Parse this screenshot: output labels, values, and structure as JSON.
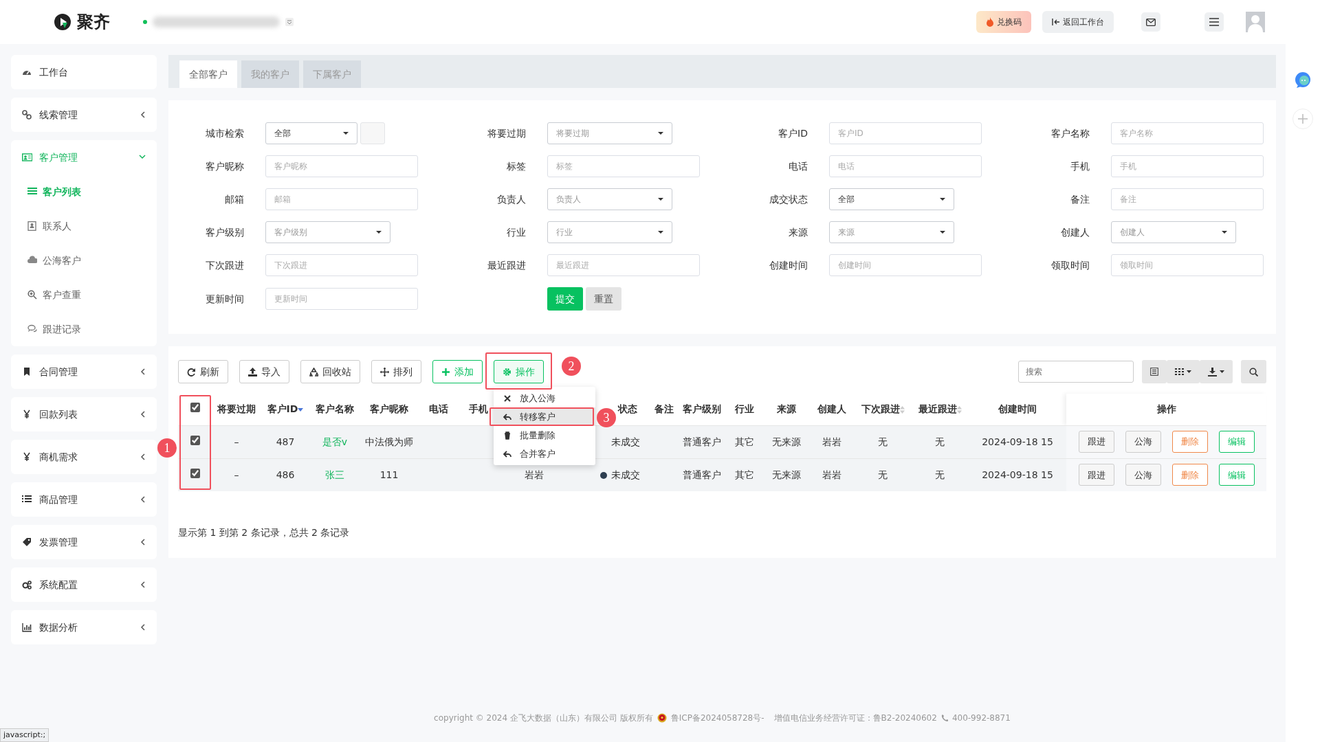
{
  "header": {
    "brand": "聚齐",
    "buttons": [
      {
        "label": "兑换码",
        "kind": "promo"
      },
      {
        "label": "返回工作台",
        "kind": "plain"
      }
    ]
  },
  "sidebar": {
    "items": [
      {
        "label": "工作台"
      },
      {
        "label": "线索管理",
        "expanded": false
      },
      {
        "label": "客户管理",
        "expanded": true,
        "children": [
          {
            "label": "客户列表",
            "selected": true
          },
          {
            "label": "联系人",
            "selected": false
          },
          {
            "label": "公海客户",
            "selected": false
          },
          {
            "label": "客户查重",
            "selected": false
          },
          {
            "label": "跟进记录",
            "selected": false
          }
        ]
      },
      {
        "label": "合同管理",
        "expanded": false
      },
      {
        "label": "回款列表",
        "expanded": false
      },
      {
        "label": "商机需求",
        "expanded": false
      },
      {
        "label": "商品管理",
        "expanded": false
      },
      {
        "label": "发票管理",
        "expanded": false
      },
      {
        "label": "系统配置",
        "expanded": false
      },
      {
        "label": "数据分析",
        "expanded": false
      }
    ]
  },
  "tabs": [
    {
      "label": "全部客户",
      "selected": true
    },
    {
      "label": "我的客户",
      "selected": false
    },
    {
      "label": "下属客户",
      "selected": false
    }
  ],
  "filters": [
    {
      "label": "城市检索",
      "kind": "select",
      "value": "全部",
      "addon": true
    },
    {
      "label": "将要过期",
      "kind": "select",
      "placeholder": "将要过期"
    },
    {
      "label": "客户ID",
      "kind": "input",
      "placeholder": "客户ID"
    },
    {
      "label": "客户名称",
      "kind": "input",
      "placeholder": "客户名称"
    },
    {
      "label": "客户昵称",
      "kind": "input",
      "placeholder": "客户昵称"
    },
    {
      "label": "标签",
      "kind": "input",
      "placeholder": "标签"
    },
    {
      "label": "电话",
      "kind": "input",
      "placeholder": "电话"
    },
    {
      "label": "手机",
      "kind": "input",
      "placeholder": "手机"
    },
    {
      "label": "邮箱",
      "kind": "input",
      "placeholder": "邮箱"
    },
    {
      "label": "负责人",
      "kind": "select",
      "placeholder": "负责人"
    },
    {
      "label": "成交状态",
      "kind": "select",
      "value": "全部"
    },
    {
      "label": "备注",
      "kind": "input",
      "placeholder": "备注"
    },
    {
      "label": "客户级别",
      "kind": "select",
      "placeholder": "客户级别"
    },
    {
      "label": "行业",
      "kind": "select",
      "placeholder": "行业"
    },
    {
      "label": "来源",
      "kind": "select",
      "placeholder": "来源"
    },
    {
      "label": "创建人",
      "kind": "select",
      "placeholder": "创建人"
    },
    {
      "label": "下次跟进",
      "kind": "input",
      "placeholder": "下次跟进"
    },
    {
      "label": "最近跟进",
      "kind": "input",
      "placeholder": "最近跟进"
    },
    {
      "label": "创建时间",
      "kind": "input",
      "placeholder": "创建时间"
    },
    {
      "label": "领取时间",
      "kind": "input",
      "placeholder": "领取时间"
    },
    {
      "label": "更新时间",
      "kind": "input",
      "placeholder": "更新时间"
    }
  ],
  "form_buttons": [
    {
      "label": "提交",
      "kind": "primary"
    },
    {
      "label": "重置",
      "kind": "secondary"
    }
  ],
  "toolbar": {
    "buttons": [
      {
        "label": "刷新",
        "kind": "default"
      },
      {
        "label": "导入",
        "kind": "default"
      },
      {
        "label": "回收站",
        "kind": "default"
      },
      {
        "label": "排列",
        "kind": "default"
      },
      {
        "label": "添加",
        "kind": "success"
      },
      {
        "label": "操作",
        "kind": "success",
        "expanded": true
      }
    ],
    "search": {
      "placeholder": "搜索"
    }
  },
  "action_menu": {
    "items": [
      {
        "label": "放入公海",
        "selected": false
      },
      {
        "label": "转移客户",
        "selected": true
      },
      {
        "label": "批量删除",
        "selected": false
      },
      {
        "label": "合并客户",
        "selected": false
      }
    ]
  },
  "table": {
    "select_all": {
      "checked": true
    },
    "columns": [
      {
        "label": "将要过期",
        "kind": "text"
      },
      {
        "label": "客户ID",
        "kind": "text",
        "sorted": true
      },
      {
        "label": "客户名称",
        "kind": "link"
      },
      {
        "label": "客户昵称",
        "kind": "text"
      },
      {
        "label": "电话",
        "kind": "text"
      },
      {
        "label": "手机",
        "kind": "text"
      },
      {
        "kind": "text"
      },
      {
        "label": "状态",
        "kind": "status"
      },
      {
        "label": "备注",
        "kind": "text"
      },
      {
        "label": "客户级别",
        "kind": "text"
      },
      {
        "label": "行业",
        "kind": "text"
      },
      {
        "label": "来源",
        "kind": "text"
      },
      {
        "label": "创建人",
        "kind": "text"
      },
      {
        "label": "下次跟进",
        "kind": "text",
        "sortable": true
      },
      {
        "label": "最近跟进",
        "kind": "text",
        "sortable": true
      },
      {
        "label": "创建时间",
        "kind": "text"
      }
    ],
    "actions_label": "操作",
    "rows": [
      {
        "checked": true,
        "cells": [
          "–",
          "487",
          "是否v",
          "中法俄为师",
          null,
          null,
          null,
          {
            "text": "未成交"
          },
          null,
          "普通客户",
          "其它",
          "无来源",
          "岩岩",
          "无",
          "无",
          "2024-09-18 15"
        ],
        "actions": [
          {
            "label": "跟进",
            "kind": "default"
          },
          {
            "label": "公海",
            "kind": "default"
          },
          {
            "label": "删除",
            "kind": "danger"
          },
          {
            "label": "编辑",
            "kind": "success"
          }
        ]
      },
      {
        "checked": true,
        "cells": [
          "–",
          "486",
          "张三",
          "111",
          null,
          null,
          "岩岩",
          {
            "text": "未成交",
            "color": "#2d3e50"
          },
          null,
          "普通客户",
          "其它",
          "无来源",
          "岩岩",
          "无",
          "无",
          "2024-09-18 15"
        ],
        "actions": [
          {
            "label": "跟进",
            "kind": "default"
          },
          {
            "label": "公海",
            "kind": "default"
          },
          {
            "label": "删除",
            "kind": "danger"
          },
          {
            "label": "编辑",
            "kind": "success"
          }
        ]
      }
    ]
  },
  "pagination_text": "显示第 1 到第 2 条记录，总共 2 条记录",
  "footer": {
    "copyright": "copyright © 2024 企飞大数据（山东）有限公司 版权所有",
    "icp": "鲁ICP备2024058728号-",
    "license": "增值电信业务经营许可证：鲁B2-20240602",
    "phone": "400-992-8871"
  },
  "status_bar": "javascript:;",
  "annotations": [
    {
      "label": "1"
    },
    {
      "label": "2"
    },
    {
      "label": "3"
    }
  ]
}
